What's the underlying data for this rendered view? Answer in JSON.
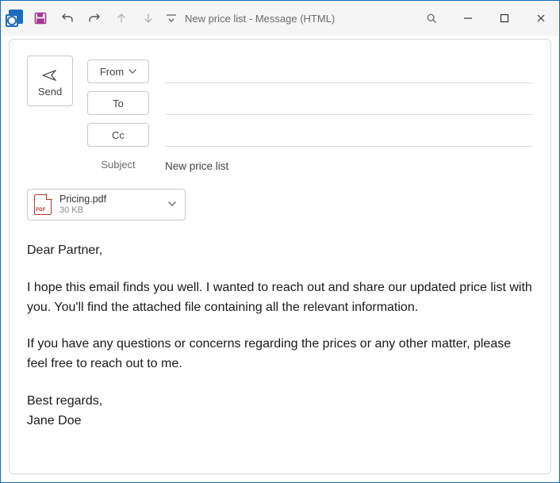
{
  "window": {
    "title": "New price list  -  Message (HTML)"
  },
  "compose": {
    "send_label": "Send",
    "from_label": "From",
    "to_label": "To",
    "cc_label": "Cc",
    "subject_label": "Subject",
    "subject_value": "New price list"
  },
  "attachment": {
    "name": "Pricing.pdf",
    "size": "30 KB",
    "badge": "PDF"
  },
  "body": {
    "greeting": "Dear Partner,",
    "p1": "I hope this email finds you well. I wanted to reach out and share our updated price list with you. You'll find the attached file containing all the relevant information.",
    "p2": "If you have any questions or concerns regarding the prices or any other matter, please feel free to reach out to me.",
    "signoff": "Best regards,",
    "sender": "Jane Doe"
  }
}
